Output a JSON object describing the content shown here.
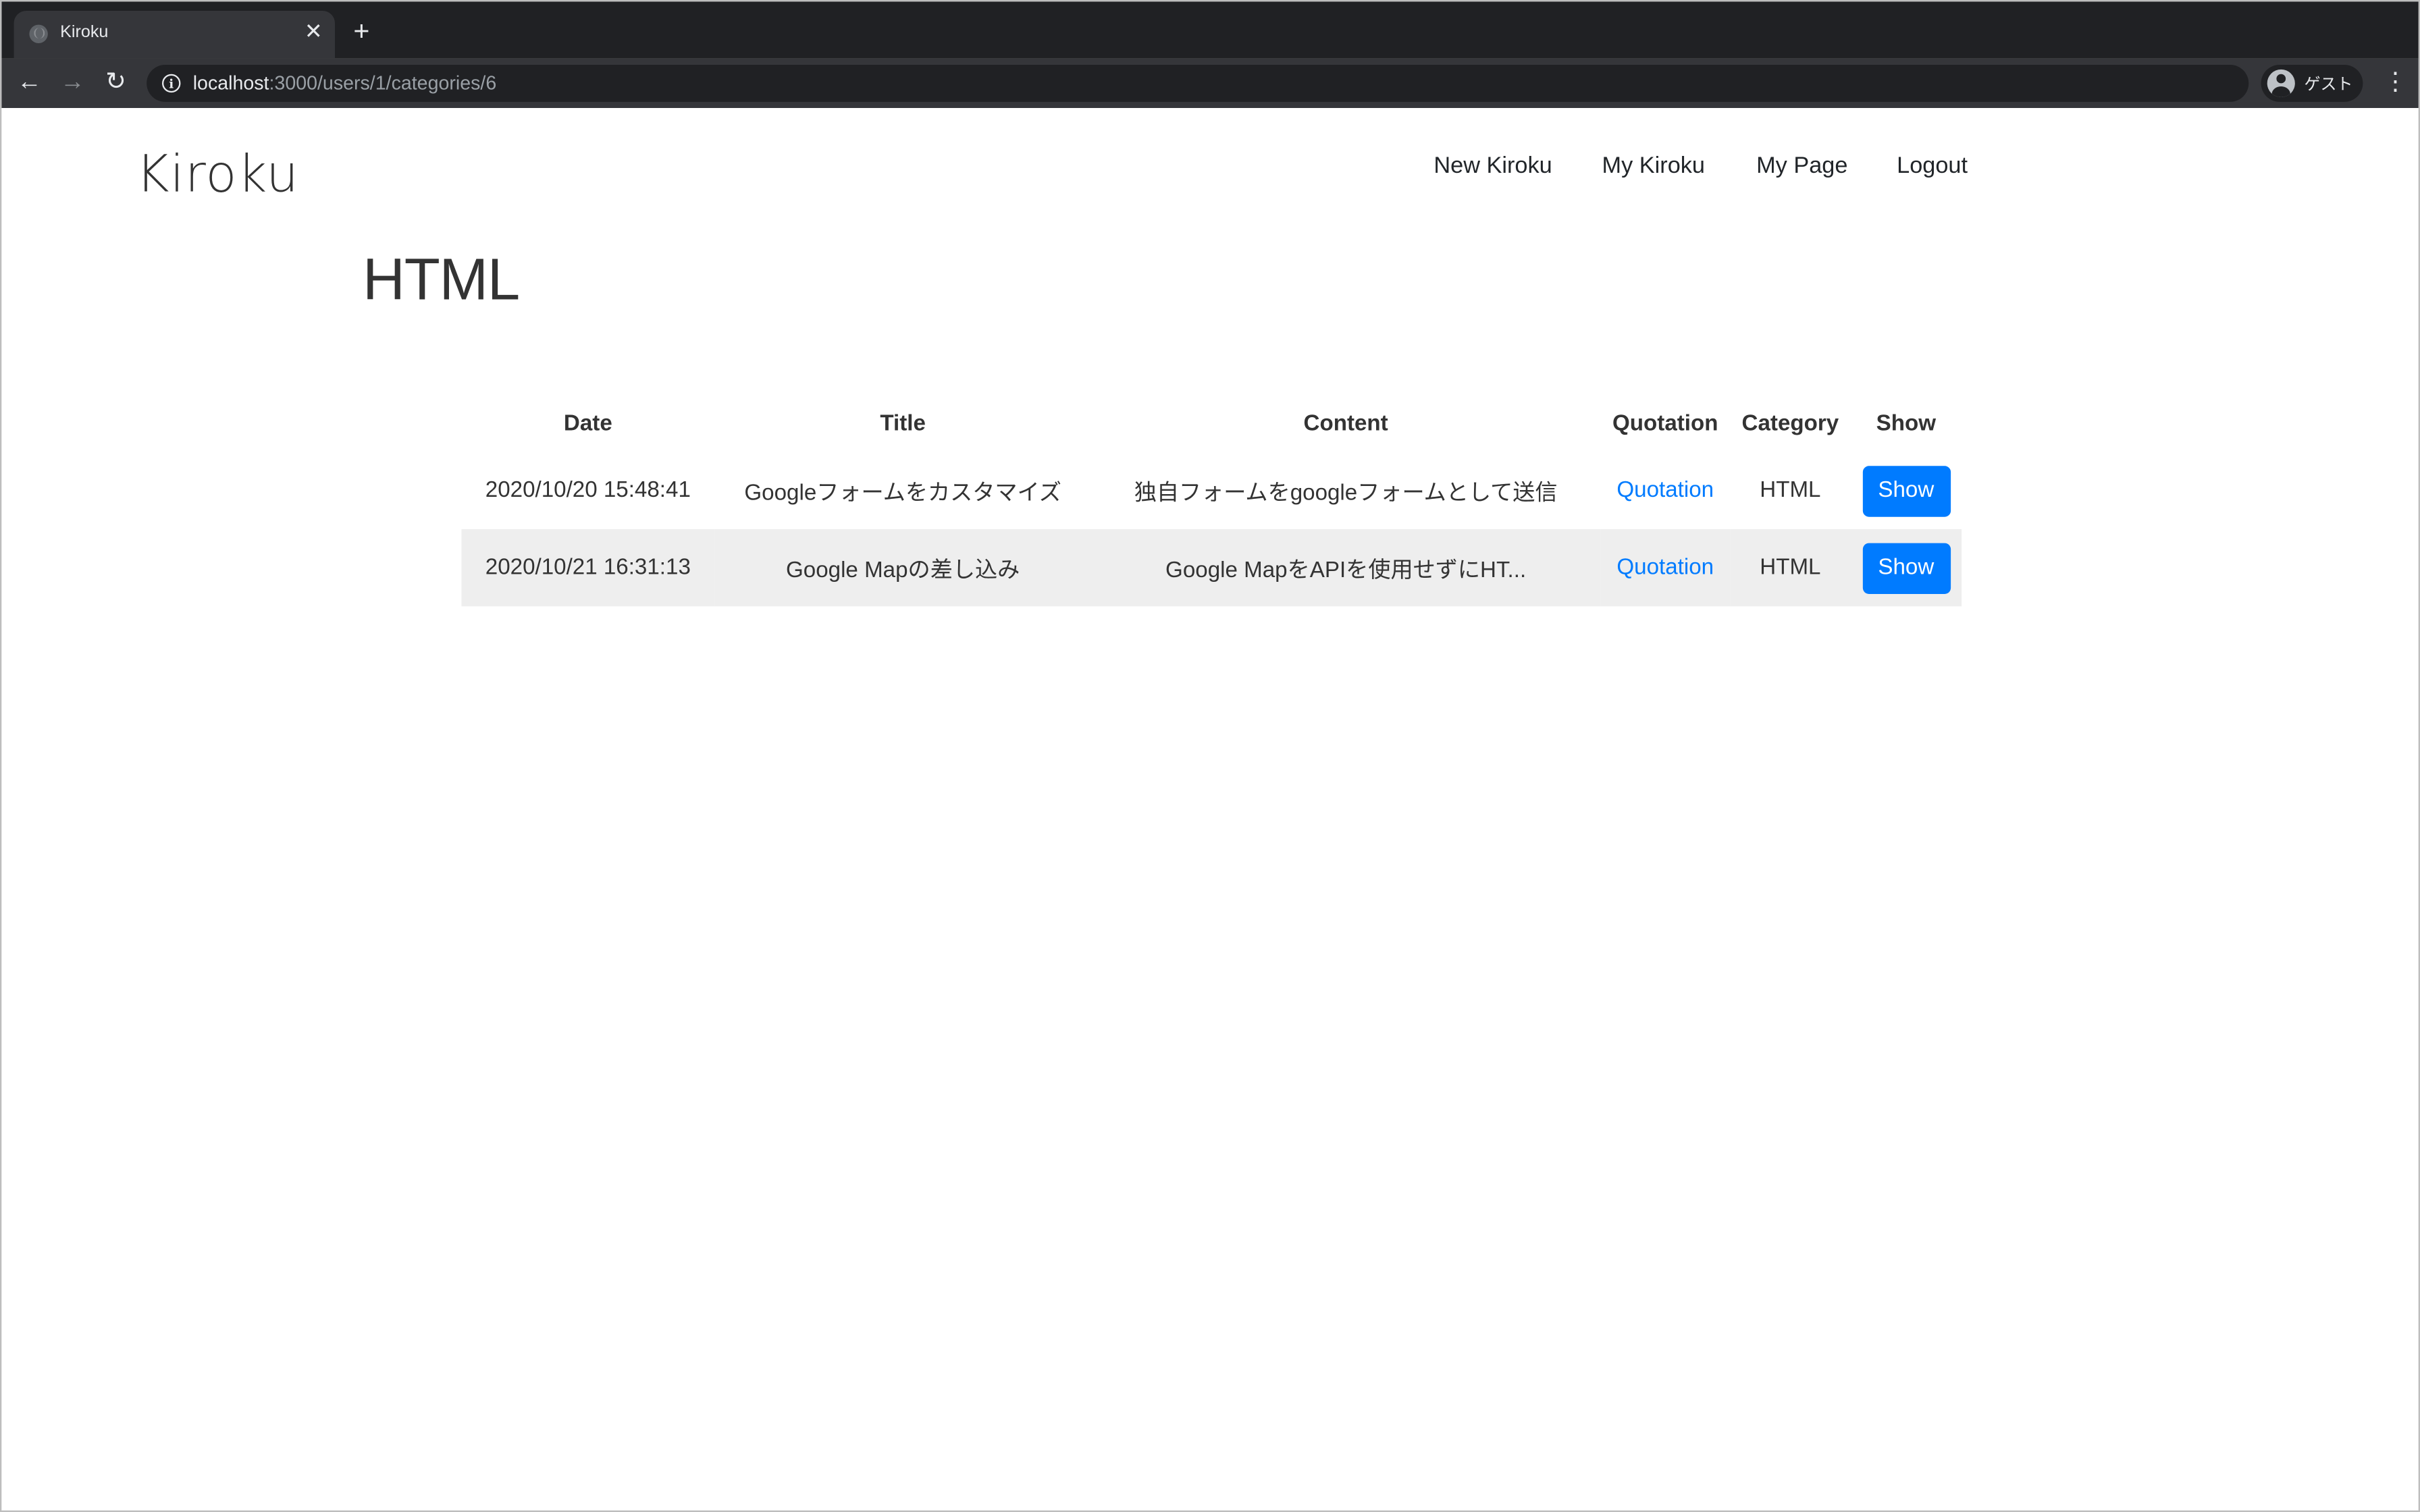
{
  "browser": {
    "tab_title": "Kiroku",
    "tab_close": "✕",
    "new_tab": "+",
    "url_host": "localhost",
    "url_path": ":3000/users/1/categories/6",
    "profile_label": "ゲスト",
    "back": "←",
    "forward": "→",
    "reload": "↻",
    "menu": "⋮"
  },
  "header": {
    "brand": "Kiroku",
    "nav": [
      "New Kiroku",
      "My Kiroku",
      "My Page",
      "Logout"
    ]
  },
  "main": {
    "title": "HTML",
    "table": {
      "headers": [
        "Date",
        "Title",
        "Content",
        "Quotation",
        "Category",
        "Show"
      ],
      "rows": [
        {
          "date": "2020/10/20 15:48:41",
          "title": "Googleフォームをカスタマイズ",
          "content": "独自フォームをgoogleフォームとして送信",
          "quotation": "Quotation",
          "category": "HTML",
          "show": "Show"
        },
        {
          "date": "2020/10/21 16:31:13",
          "title": "Google Mapの差し込み",
          "content": "Google MapをAPIを使用せずにHT...",
          "quotation": "Quotation",
          "category": "HTML",
          "show": "Show"
        }
      ]
    }
  },
  "colors": {
    "accent": "#007bff",
    "stripe": "#eeeeee",
    "chrome_dark": "#202124",
    "chrome_tab": "#35363a"
  }
}
